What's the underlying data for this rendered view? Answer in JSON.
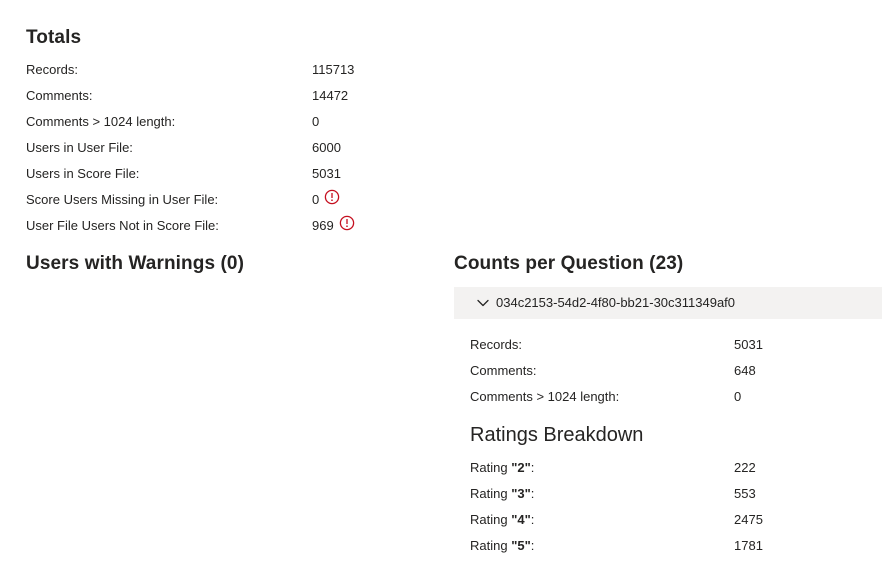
{
  "totals": {
    "title": "Totals",
    "rows": [
      {
        "label": "Records:",
        "value": "115713"
      },
      {
        "label": "Comments:",
        "value": "14472"
      },
      {
        "label": "Comments > 1024 length:",
        "value": "0"
      },
      {
        "label": "Users in User File:",
        "value": "6000"
      },
      {
        "label": "Users in Score File:",
        "value": "5031"
      },
      {
        "label": "Score Users Missing in User File:",
        "value": "0",
        "icon": "warning-icon"
      },
      {
        "label": "User File Users Not in Score File:",
        "value": "969",
        "icon": "warning-icon"
      }
    ]
  },
  "warnings": {
    "title": "Users with Warnings (0)"
  },
  "counts": {
    "title": "Counts per Question (23)",
    "accordion": {
      "label": "034c2153-54d2-4f80-bb21-30c311349af0",
      "icon": "chevron-down-icon",
      "rows": [
        {
          "label": "Records:",
          "value": "5031"
        },
        {
          "label": "Comments:",
          "value": "648"
        },
        {
          "label": "Comments > 1024 length:",
          "value": "0"
        }
      ],
      "ratings": {
        "title": "Ratings Breakdown",
        "prefix": "Rating",
        "rows": [
          {
            "rating": "\"2\"",
            "suffix": ":",
            "value": "222"
          },
          {
            "rating": "\"3\"",
            "suffix": ":",
            "value": "553"
          },
          {
            "rating": "\"4\"",
            "suffix": ":",
            "value": "2475"
          },
          {
            "rating": "\"5\"",
            "suffix": ":",
            "value": "1781"
          }
        ]
      }
    }
  },
  "colors": {
    "warning": "#c50f1f",
    "accordion_bg": "#f3f2f1",
    "text": "#252423"
  }
}
